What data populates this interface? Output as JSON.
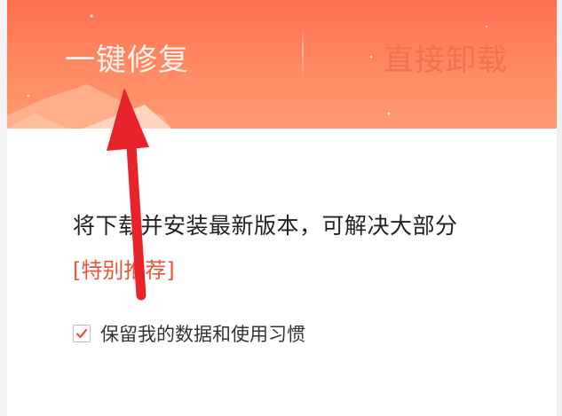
{
  "colors": {
    "header_top": "#ff6f52",
    "header_bottom": "#ff9a70",
    "accent_red": "#e8553a",
    "arrow_red": "#e8232b",
    "text_dark": "#222222"
  },
  "tabs": [
    {
      "label": "一键修复",
      "active": true
    },
    {
      "label": "直接卸载",
      "active": false
    }
  ],
  "main": {
    "description": "将下载并安装最新版本，可解决大部分",
    "recommend_label": "[特别推荐]",
    "keep_data": {
      "label": "保留我的数据和使用习惯",
      "checked": true,
      "icon": "checkmark-icon"
    }
  },
  "annotation": {
    "icon": "red-arrow-pointing-up"
  }
}
